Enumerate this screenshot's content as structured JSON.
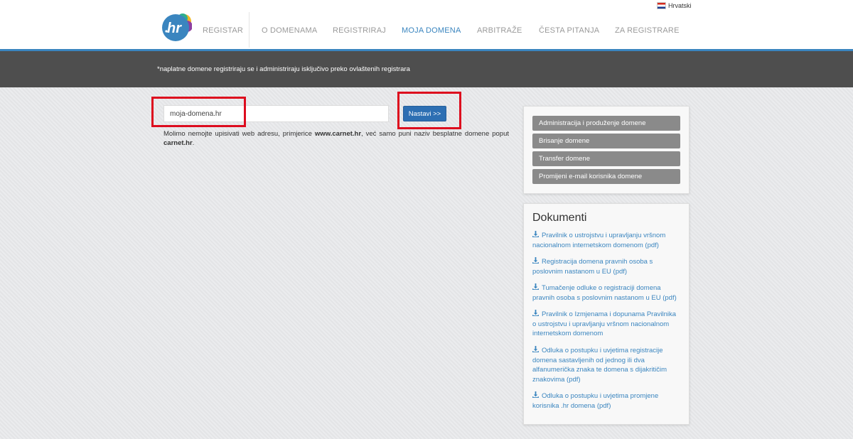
{
  "header": {
    "language": "Hrvatski",
    "nav": [
      {
        "label": "REGISTAR",
        "active": false
      },
      {
        "label": "O DOMENAMA",
        "active": false
      },
      {
        "label": "REGISTRIRAJ",
        "active": false
      },
      {
        "label": "MOJA DOMENA",
        "active": true
      },
      {
        "label": "ARBITRAŽE",
        "active": false
      },
      {
        "label": "ČESTA PITANJA",
        "active": false
      },
      {
        "label": "ZA REGISTRARE",
        "active": false
      }
    ]
  },
  "banner": {
    "text": "*naplatne domene registriraju se i administriraju isključivo preko ovlaštenih registrara"
  },
  "form": {
    "domain_value": "moja-domena.hr",
    "submit_label": "Nastavi >>",
    "hint_before": "Molimo nemojte upisivati web adresu, primjerice ",
    "hint_example": "www.carnet.hr",
    "hint_middle": ", već samo puni naziv besplatne domene poput ",
    "hint_domain": "carnet.hr",
    "hint_end": "."
  },
  "admin_menu": {
    "items": [
      "Administracija i produženje domene",
      "Brisanje domene",
      "Transfer domene",
      "Promijeni e-mail korisnika domene"
    ]
  },
  "documents": {
    "title": "Dokumenti",
    "items": [
      "Pravilnik o ustrojstvu i upravljanju vršnom nacionalnom internetskom domenom (pdf)",
      "Registracija domena pravnih osoba s poslovnim nastanom u EU (pdf)",
      "Tumačenje odluke o registraciji domena pravnih osoba s poslovnim nastanom u EU (pdf)",
      "Pravilnik o Izmjenama i dopunama Pravilnika o ustrojstvu i upravljanju vršnom nacionalnom internetskom domenom",
      "Odluka o postupku i uvjetima registracije domena sastavljenih od jednog ili dva alfanumerička znaka te domena s dijakritičim znakovima (pdf)",
      "Odluka o postupku i uvjetima promjene korisnika .hr domena (pdf)"
    ]
  },
  "colors": {
    "accent": "#3a85bf",
    "banner_bg": "#4e4e4e",
    "highlight": "#dd0c1e",
    "button_blue": "#2d6fb3",
    "admin_button": "#8a8a8a"
  }
}
